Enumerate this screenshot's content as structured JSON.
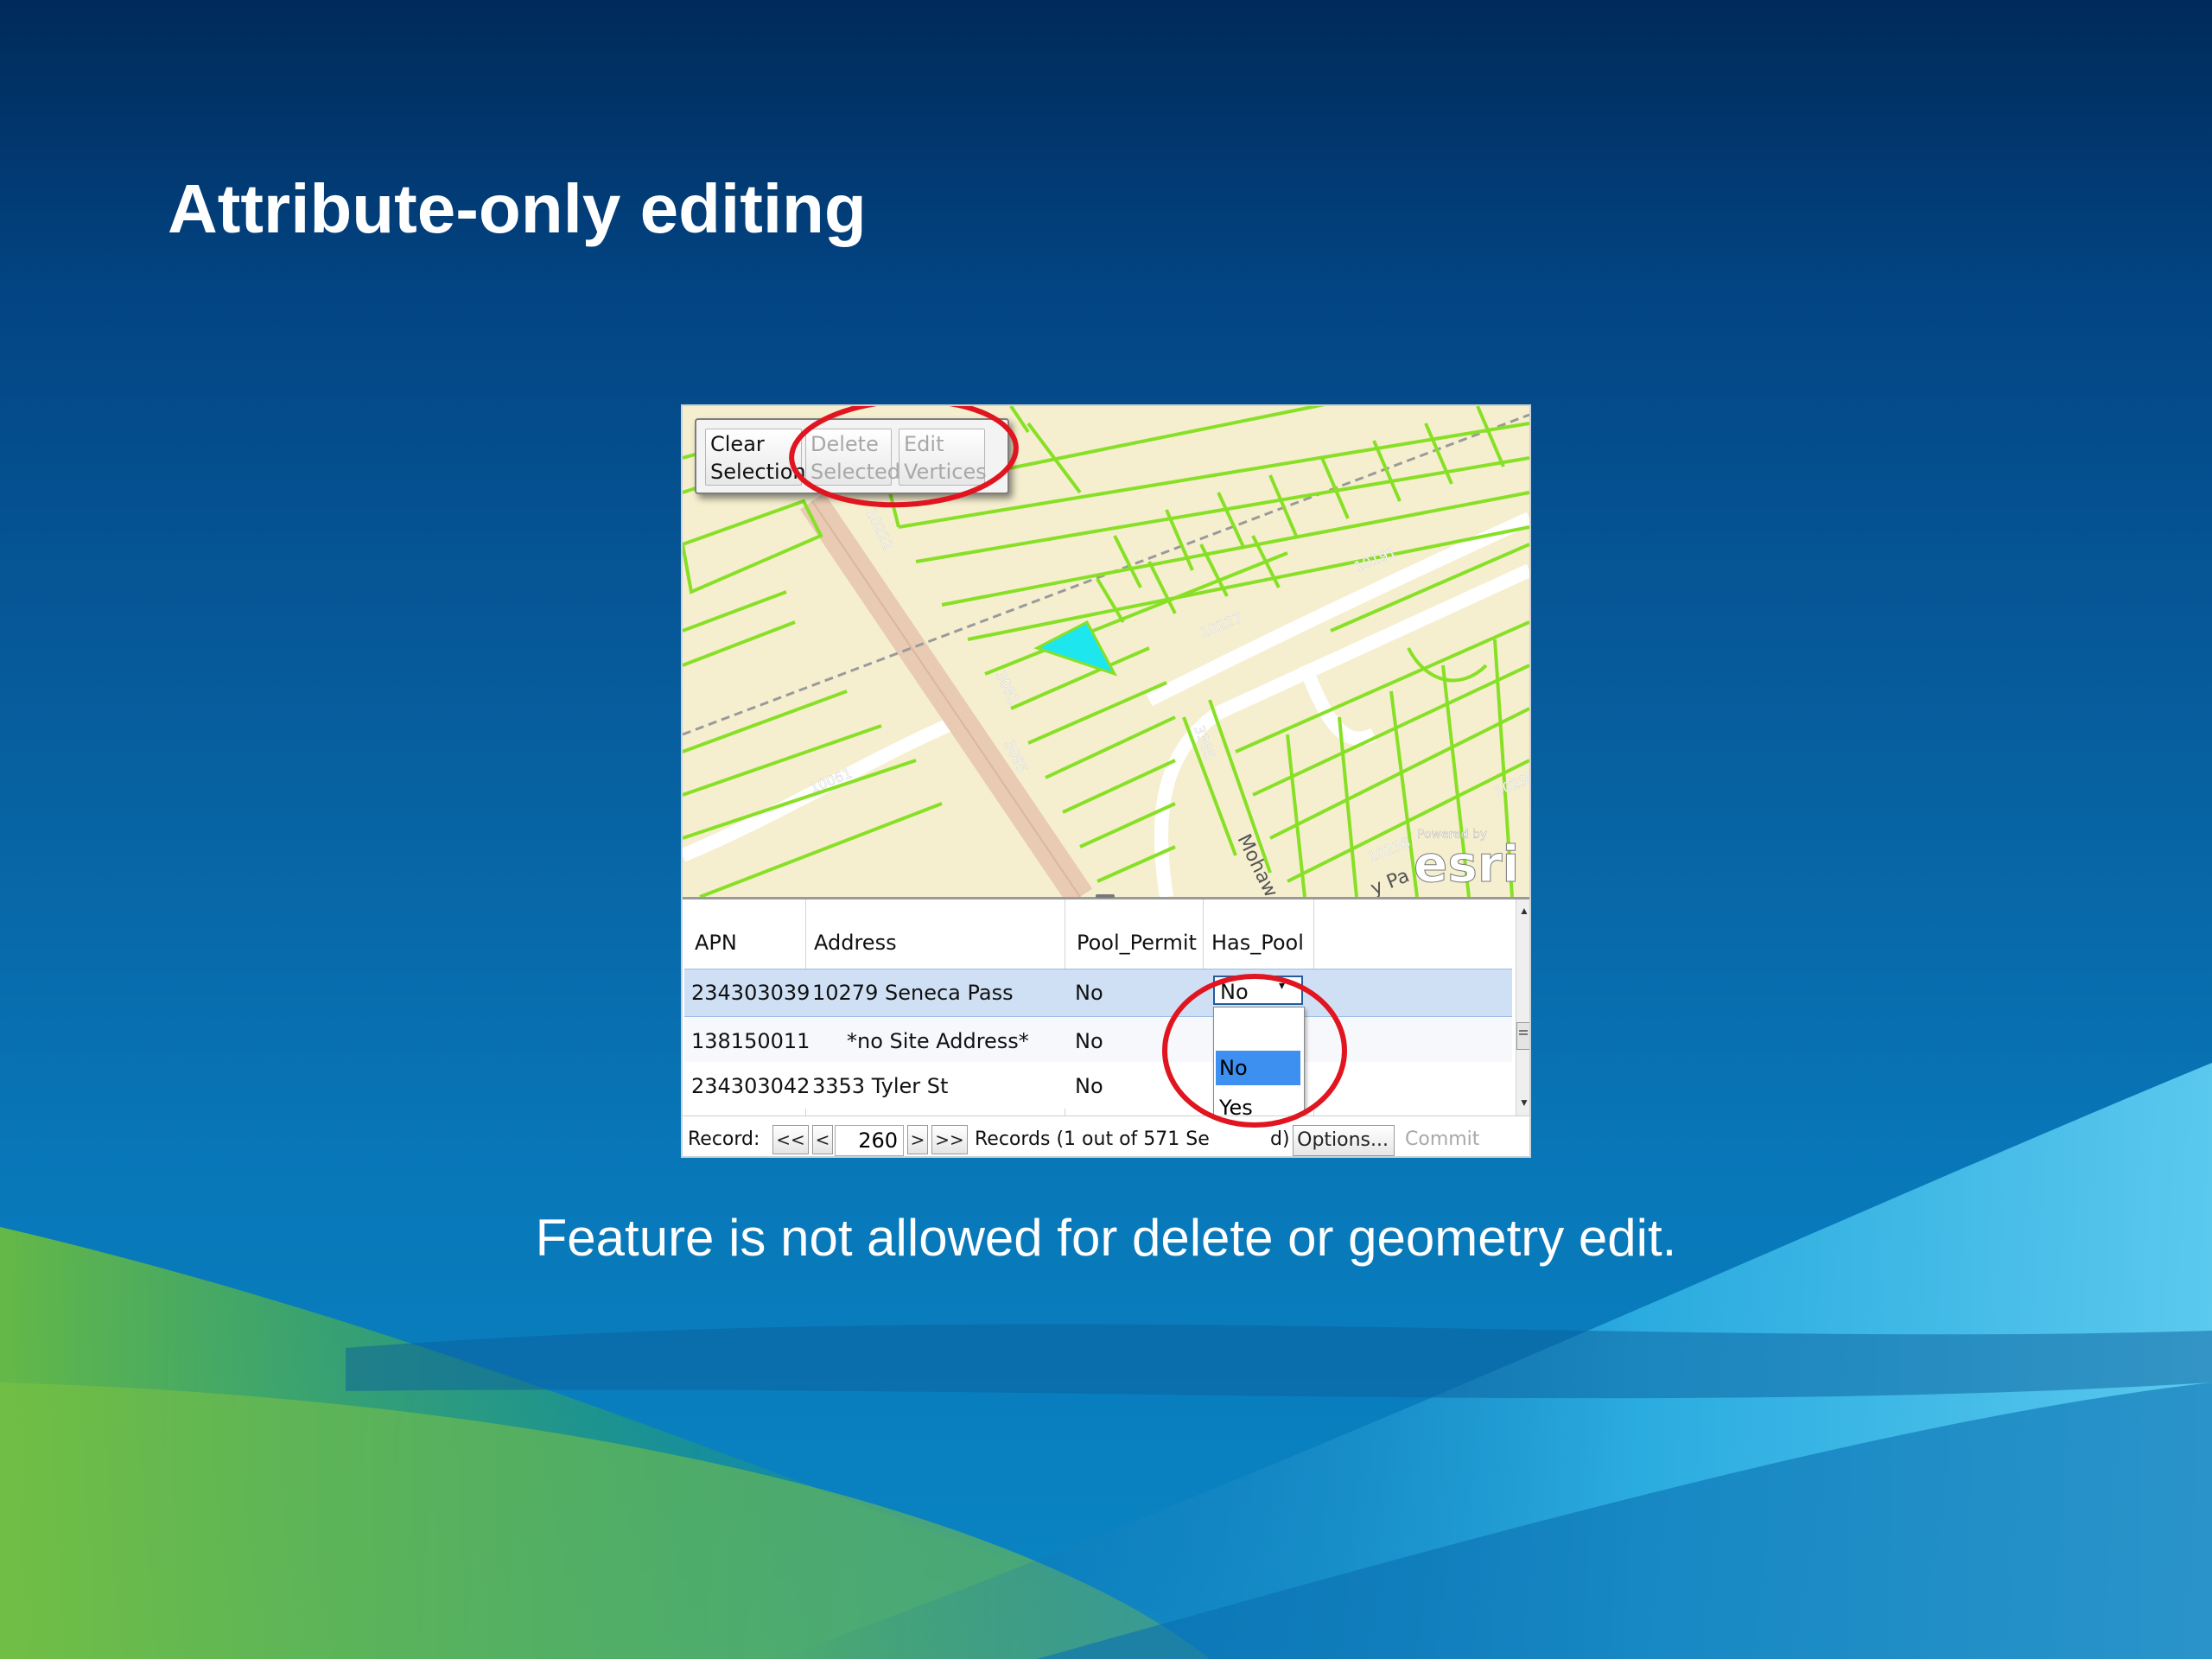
{
  "slide": {
    "title": "Attribute-only editing",
    "caption": "Feature is not allowed for delete or geometry edit."
  },
  "toolbar": {
    "clear_line1": "Clear",
    "clear_line2": "Selection",
    "delete_line1": "Delete",
    "delete_line2": "Selected",
    "edit_line1": "Edit",
    "edit_line2": "Vertices"
  },
  "map": {
    "labels": [
      "10222",
      "10191",
      "10227",
      "10061",
      "3095",
      "3081",
      "3385",
      "10230",
      "Mohaw",
      "10236",
      "y Pa"
    ],
    "esri_powered": "Powered by",
    "esri_logo": "esri"
  },
  "table": {
    "columns": [
      "APN",
      "Address",
      "Pool_Permit",
      "Has_Pool"
    ],
    "rows": [
      {
        "apn": "234303039",
        "address": "10279 Seneca Pass",
        "pool_permit": "No",
        "has_pool": "No"
      },
      {
        "apn": "138150011",
        "address": "*no Site Address*",
        "pool_permit": "No",
        "has_pool": ""
      },
      {
        "apn": "234303042",
        "address": "3353  Tyler St",
        "pool_permit": "No",
        "has_pool": ""
      }
    ],
    "dropdown": {
      "selected": "No",
      "options": [
        "",
        "No",
        "Yes"
      ]
    }
  },
  "navigation": {
    "record_label": "Record:",
    "first": "<<",
    "prev": "<",
    "record_value": "260",
    "next": ">",
    "last": ">>",
    "records_text": "Records (1 out of 571 Se",
    "records_text_tail": "d)",
    "options_label": "Options...",
    "commit_label": "Commit"
  },
  "colors": {
    "parcel_line": "#88e026",
    "map_background": "#f5efcf",
    "selected_parcel": "#1ee6ef",
    "highlight_circle": "#e0151f",
    "selected_row": "#cfe0f5"
  }
}
